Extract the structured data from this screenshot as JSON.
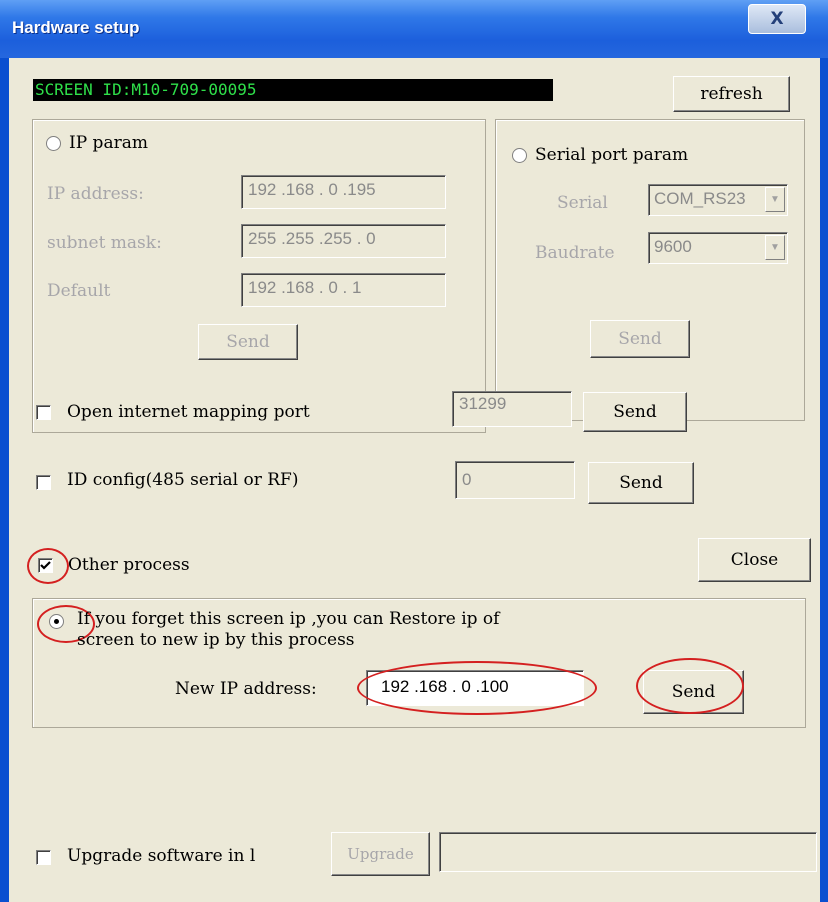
{
  "window": {
    "title": "Hardware setup",
    "close_glyph": "X"
  },
  "screen_id": "SCREEN ID:M10-709-00095",
  "refresh_label": "refresh",
  "ip_group": {
    "title": "IP param",
    "ip_label": "IP address:",
    "ip_value": "192 .168 .  0  .195",
    "mask_label": "subnet mask:",
    "mask_value": "255 .255 .255 .  0",
    "gateway_label": "Default",
    "gateway_value": "192 .168 .  0  .  1",
    "send_label": "Send"
  },
  "serial_group": {
    "title": "Serial port param",
    "serial_label": "Serial",
    "serial_value": "COM_RS23",
    "baud_label": "Baudrate",
    "baud_value": "9600",
    "send_label": "Send"
  },
  "mapping": {
    "label": "Open internet mapping port",
    "value": "31299",
    "send_label": "Send"
  },
  "id_config": {
    "label": "ID config(485 serial or RF)",
    "value": "0",
    "send_label": "Send"
  },
  "other_process": {
    "label": "Other process",
    "checked": true
  },
  "close_label": "Close",
  "restore": {
    "line1": "If you forget this screen ip ,you can Restore ip of",
    "line2": "screen to new ip by this process",
    "new_ip_label": "New IP address:",
    "new_ip_value": "192 .168 .  0  .100",
    "send_label": "Send"
  },
  "upgrade": {
    "label": "Upgrade software in l",
    "button_label": "Upgrade",
    "value": ""
  },
  "colors": {
    "annotation": "#d42020",
    "id_text": "#2fe04a",
    "title_bar": "#2567de"
  }
}
